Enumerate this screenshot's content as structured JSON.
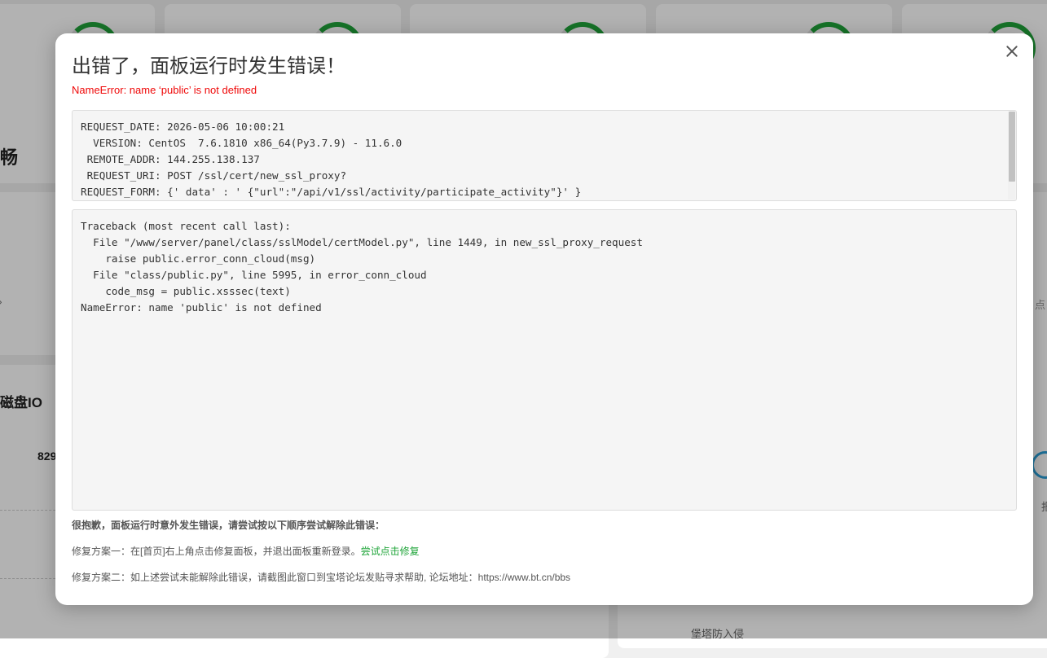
{
  "background": {
    "partial_title_left": "畅",
    "disk_io_label": "磁盘IO",
    "number_partial": "829",
    "right_text_partial": "点",
    "right_text_partial2": "报",
    "bottom_text": "堡塔防入侵"
  },
  "dialog": {
    "title": "出错了，面板运行时发生错误！",
    "error_summary": "NameError: name ‘public’ is not defined",
    "request_info": "REQUEST_DATE: 2026-05-06 10:00:21\n  VERSION: CentOS  7.6.1810 x86_64(Py3.7.9) - 11.6.0\n REMOTE_ADDR: 144.255.138.137\n REQUEST_URI: POST /ssl/cert/new_ssl_proxy?\nREQUEST_FORM: {' data' : ' {\"url\":\"/api/v1/ssl/activity/participate_activity\"}' }",
    "traceback": "Traceback (most recent call last):\n  File \"/www/server/panel/class/sslModel/certModel.py\", line 1449, in new_ssl_proxy_request\n    raise public.error_conn_cloud(msg)\n  File \"class/public.py\", line 5995, in error_conn_cloud\n    code_msg = public.xsssec(text)\nNameError: name 'public' is not defined",
    "help_title": "很抱歉，面板运行时意外发生错误，请尝试按以下顺序尝试解除此错误：",
    "fix1_text": "修复方案一：在[首页]右上角点击修复面板，并退出面板重新登录。",
    "fix1_link": "尝试点击修复",
    "fix2_text": "修复方案二：如上述尝试未能解除此错误，请截图此窗口到宝塔论坛发贴寻求帮助, 论坛地址：https://www.bt.cn/bbs"
  },
  "colors": {
    "error_red": "#ef0808",
    "link_green": "#20a53a"
  },
  "icons": {
    "close": "close-icon"
  }
}
